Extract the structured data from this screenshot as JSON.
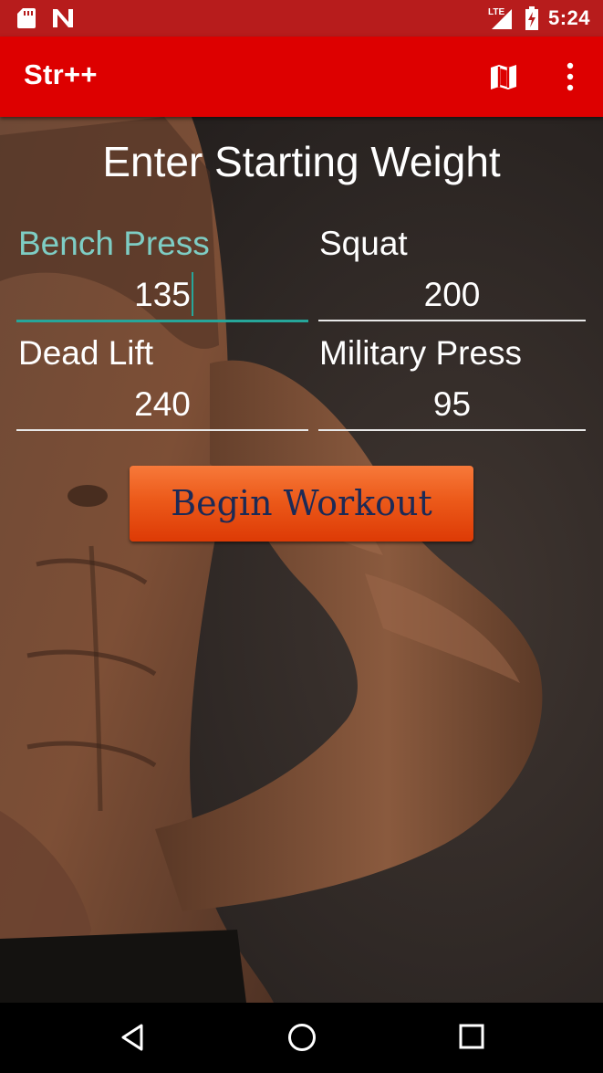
{
  "status_bar": {
    "network": "LTE",
    "time": "5:24",
    "icons": [
      "sd-card-icon",
      "n-notification-icon",
      "signal-icon",
      "battery-icon"
    ]
  },
  "app_bar": {
    "title": "Str++",
    "actions": [
      "map-icon",
      "overflow-menu-icon"
    ]
  },
  "form": {
    "heading": "Enter Starting Weight",
    "fields": [
      {
        "label": "Bench Press",
        "value": "135",
        "focused": true
      },
      {
        "label": "Squat",
        "value": "200",
        "focused": false
      },
      {
        "label": "Dead Lift",
        "value": "240",
        "focused": false
      },
      {
        "label": "Military Press",
        "value": "95",
        "focused": false
      }
    ],
    "submit_label": "Begin Workout"
  },
  "nav_bar": {
    "buttons": [
      "back-icon",
      "home-icon",
      "recents-icon"
    ]
  },
  "colors": {
    "status_bar": "#b71c1c",
    "app_bar": "#dd0000",
    "accent": "#26a69a",
    "button": "#ec5a1a",
    "button_text": "#1c2a56"
  }
}
